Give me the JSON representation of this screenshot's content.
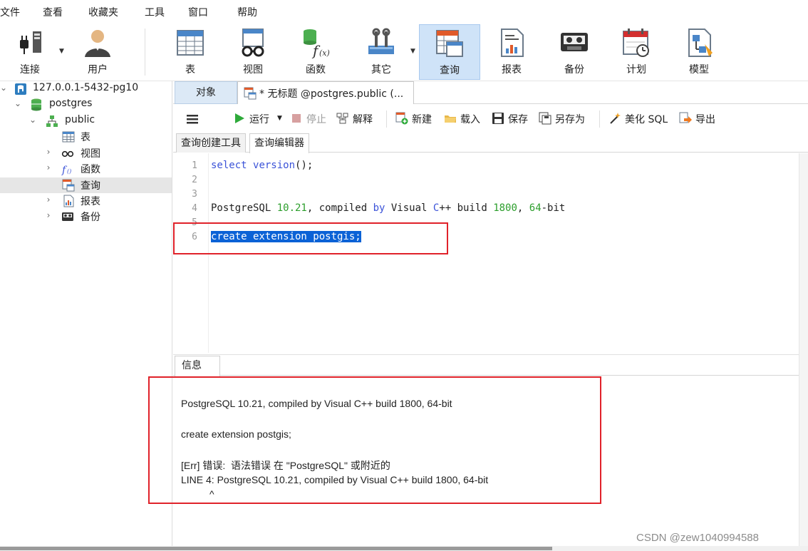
{
  "menubar": {
    "items": [
      "文件",
      "查看",
      "收藏夹",
      "工具",
      "窗口",
      "帮助"
    ]
  },
  "toolbar": {
    "buttons": [
      {
        "label": "连接",
        "icon": "plug-connection-icon"
      },
      {
        "label": "用户",
        "icon": "user-icon"
      },
      {
        "label": "表",
        "icon": "table-icon"
      },
      {
        "label": "视图",
        "icon": "view-glasses-icon"
      },
      {
        "label": "函数",
        "icon": "function-fx-icon"
      },
      {
        "label": "其它",
        "icon": "tools-icon"
      },
      {
        "label": "查询",
        "icon": "query-table-icon",
        "active": true
      },
      {
        "label": "报表",
        "icon": "report-icon"
      },
      {
        "label": "备份",
        "icon": "backup-tape-icon"
      },
      {
        "label": "计划",
        "icon": "calendar-clock-icon"
      },
      {
        "label": "模型",
        "icon": "model-diagram-icon"
      }
    ]
  },
  "tree": {
    "items": [
      {
        "label": "127.0.0.1-5432-pg10",
        "icon": "server-elephant-icon",
        "expanded": true
      },
      {
        "label": "postgres",
        "icon": "database-icon",
        "expanded": true
      },
      {
        "label": "public",
        "icon": "schema-icon",
        "expanded": true
      },
      {
        "label": "表",
        "icon": "table-icon"
      },
      {
        "label": "视图",
        "icon": "view-glasses-icon"
      },
      {
        "label": "函数",
        "icon": "function-fx-icon"
      },
      {
        "label": "查询",
        "icon": "query-table-icon",
        "selected": true
      },
      {
        "label": "报表",
        "icon": "report-icon"
      },
      {
        "label": "备份",
        "icon": "backup-tape-icon"
      }
    ]
  },
  "tabs": {
    "objects": "对象",
    "query": "* 无标题 @postgres.public (..."
  },
  "query_toolbar": {
    "menu": "menu-icon",
    "run": "运行",
    "stop": "停止",
    "explain": "解释",
    "new": "新建",
    "load": "载入",
    "save": "保存",
    "save_as": "另存为",
    "beautify": "美化 SQL",
    "export": "导出"
  },
  "subtabs": {
    "builder": "查询创建工具",
    "editor": "查询编辑器"
  },
  "editor": {
    "line_numbers": [
      "1",
      "2",
      "3",
      "4",
      "5",
      "6"
    ],
    "line1": {
      "kw1": "select",
      "sp": " ",
      "kw2": "version",
      "rest": "();"
    },
    "line4": {
      "t1": "PostgreSQL ",
      "n1": "10.21",
      "t2": ", compiled ",
      "k1": "by",
      "t3": " Visual ",
      "k2": "C",
      "t4": "++ build ",
      "n2": "1800",
      "t5": ", ",
      "n3": "64",
      "t6": "-bit"
    },
    "line6": "create extension postgis;"
  },
  "info": {
    "tab_label": "信息",
    "lines": [
      "PostgreSQL 10.21, compiled by Visual C++ build 1800, 64-bit",
      "create extension postgis;",
      "[Err] 错误:  语法错误 在 \"PostgreSQL\" 或附近的",
      "LINE 4: PostgreSQL 10.21, compiled by Visual C++ build 1800, 64-bit",
      "^"
    ]
  },
  "watermark": "CSDN @zew1040994588",
  "colors": {
    "keyword": "#3b53d8",
    "number": "#2c9e2c",
    "selection": "#0b62d6",
    "highlight_box": "#e0222a",
    "active_tab": "#dce9f6"
  }
}
